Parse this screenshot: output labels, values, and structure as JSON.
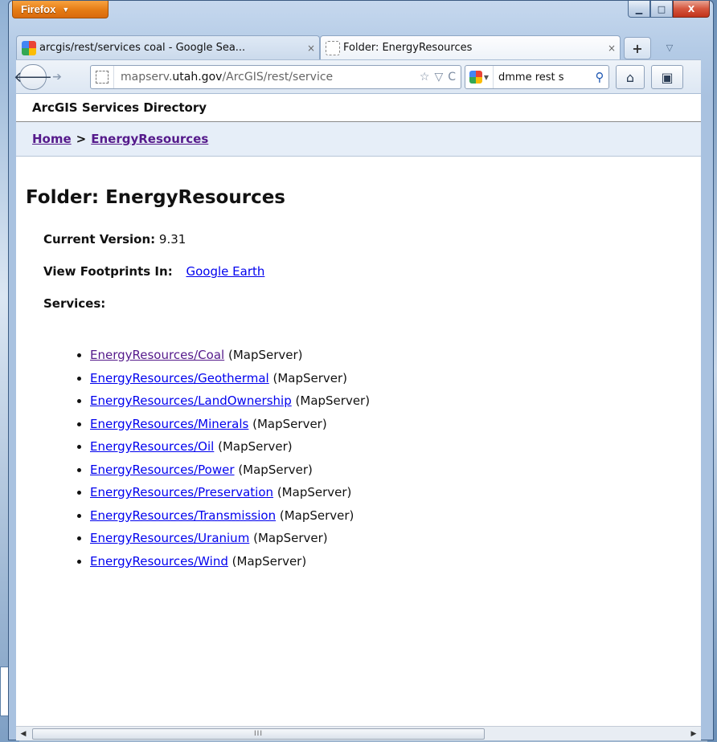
{
  "app": {
    "menu_button": "Firefox",
    "menu_button_arrow": "▼",
    "window_controls": {
      "minimize": "▁",
      "maximize": "□",
      "close": "X"
    }
  },
  "tabs": [
    {
      "label": "arcgis/rest/services coal - Google Sea...",
      "close": "×",
      "favicon": "google-icon"
    },
    {
      "label": "Folder: EnergyResources",
      "close": "×",
      "favicon": "blank-page-icon"
    }
  ],
  "tabstrip": {
    "new_tab": "+",
    "list_tabs": "▽"
  },
  "navbar": {
    "back": "🡐",
    "forward": "➔",
    "url_prefix": "mapserv.",
    "url_domain": "utah.gov",
    "url_suffix": "/ArcGIS/rest/service",
    "bookmark_star": "☆",
    "history_dropdown": "▽",
    "reload": "C",
    "search_text": "dmme rest s",
    "search_dropdown": "▼",
    "search_go": "⚲",
    "home": "⌂",
    "bookmarks": "▣"
  },
  "page": {
    "header": "ArcGIS Services Directory",
    "breadcrumb_home": "Home",
    "breadcrumb_sep": ">",
    "breadcrumb_current": "EnergyResources",
    "title": "Folder: EnergyResources",
    "current_version_label": "Current Version:",
    "current_version": "9.31",
    "footprints_label": "View Footprints In:",
    "footprints_link": "Google Earth",
    "services_label": "Services:",
    "services": [
      {
        "name": "EnergyResources/Coal",
        "type": "(MapServer)",
        "visited": true
      },
      {
        "name": "EnergyResources/Geothermal",
        "type": "(MapServer)",
        "visited": false
      },
      {
        "name": "EnergyResources/LandOwnership",
        "type": "(MapServer)",
        "visited": false
      },
      {
        "name": "EnergyResources/Minerals",
        "type": "(MapServer)",
        "visited": false
      },
      {
        "name": "EnergyResources/Oil",
        "type": "(MapServer)",
        "visited": false
      },
      {
        "name": "EnergyResources/Power",
        "type": "(MapServer)",
        "visited": false
      },
      {
        "name": "EnergyResources/Preservation",
        "type": "(MapServer)",
        "visited": false
      },
      {
        "name": "EnergyResources/Transmission",
        "type": "(MapServer)",
        "visited": false
      },
      {
        "name": "EnergyResources/Uranium",
        "type": "(MapServer)",
        "visited": false
      },
      {
        "name": "EnergyResources/Wind",
        "type": "(MapServer)",
        "visited": false
      }
    ]
  },
  "scrollbar": {
    "left": "◀",
    "right": "▶",
    "grip": "III",
    "thumb_fraction": 0.69
  },
  "colors": {
    "link": "#0000ee",
    "visited": "#551a8b",
    "firefox_orange": "#e57b14"
  }
}
